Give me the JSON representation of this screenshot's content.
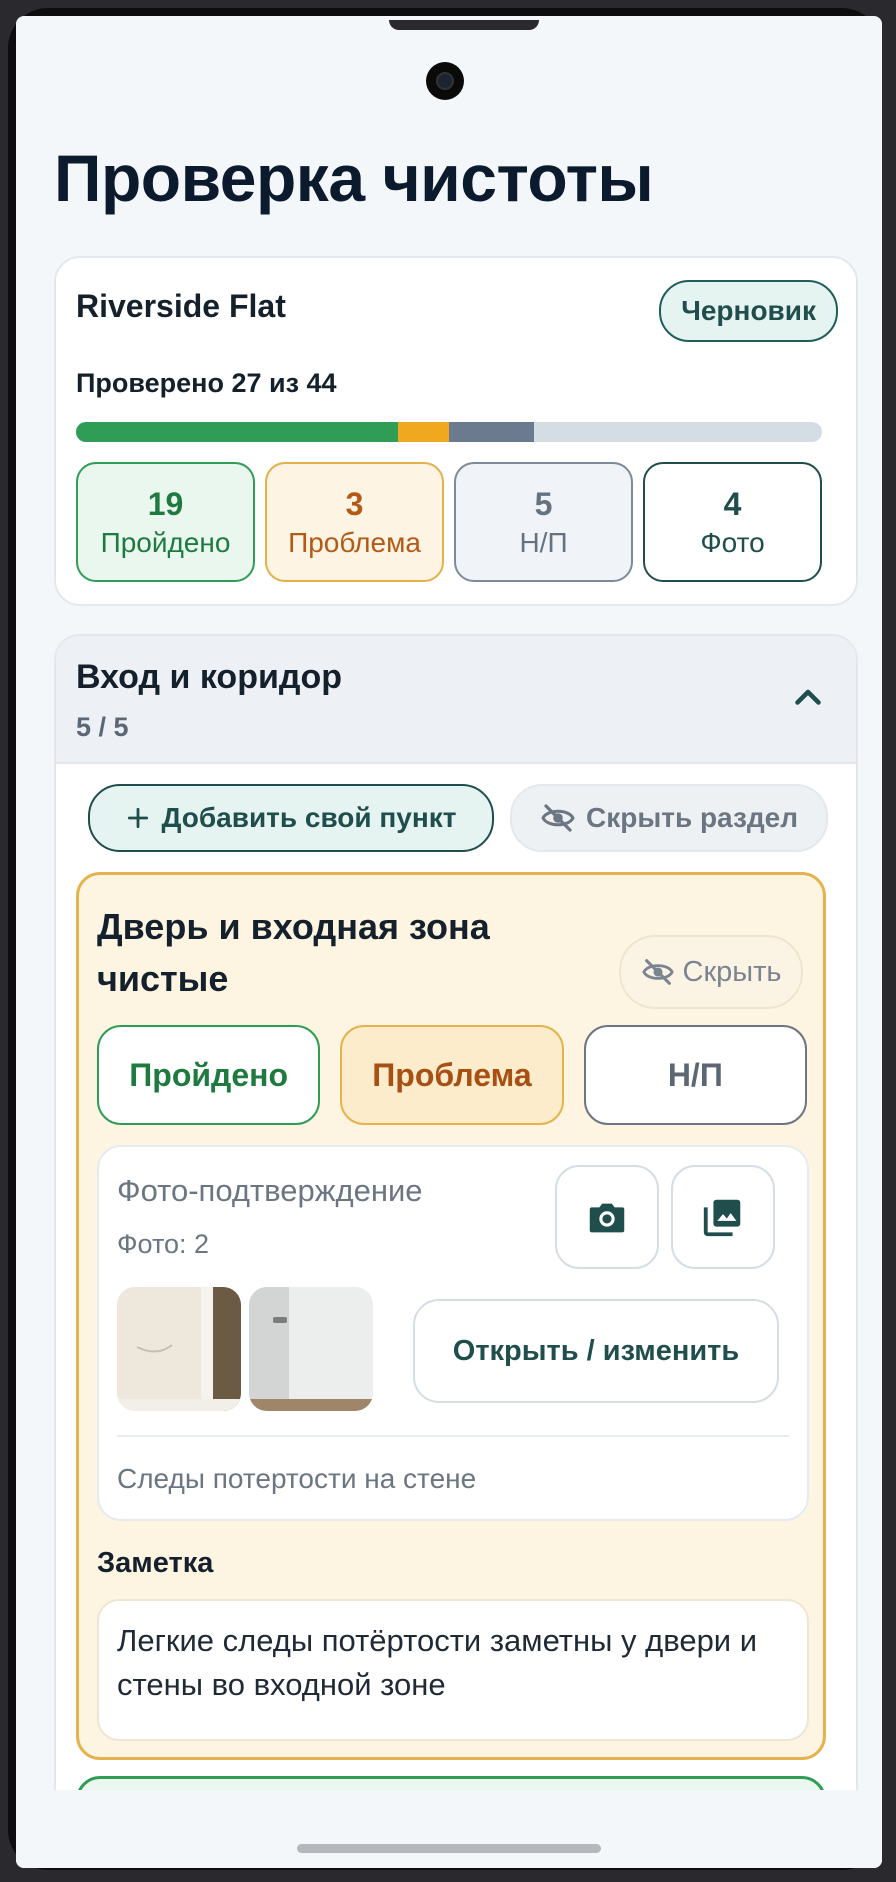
{
  "page": {
    "title": "Проверка чистоты"
  },
  "summary": {
    "property": "Riverside Flat",
    "status": "Черновик",
    "checked_text": "Проверено 27 из 44",
    "progress": {
      "pass": 19,
      "problem": 3,
      "na": 5,
      "total": 44
    },
    "stats": [
      {
        "value": "19",
        "label": "Пройдено"
      },
      {
        "value": "3",
        "label": "Проблема"
      },
      {
        "value": "5",
        "label": "Н/П"
      },
      {
        "value": "4",
        "label": "Фото"
      }
    ]
  },
  "section": {
    "title": "Вход и коридор",
    "count": "5 / 5",
    "add_label": "Добавить свой пункт",
    "hide_label": "Скрыть раздел"
  },
  "item": {
    "title": "Дверь и входная зона чистые",
    "hide_label": "Скрыть",
    "choices": {
      "pass": "Пройдено",
      "problem": "Проблема",
      "na": "Н/П"
    },
    "selected": "problem",
    "photo": {
      "title": "Фото-подтверждение",
      "count": "Фото: 2",
      "open_label": "Открыть / изменить",
      "caption": "Следы потертости на стене"
    },
    "note_label": "Заметка",
    "note": "Легкие следы потёртости заметны у двери и стены во входной зоне"
  },
  "colors": {
    "pass": "#2f9d56",
    "problem": "#f0a81e",
    "na": "#6b7a8f",
    "accent": "#1f4e4d"
  }
}
